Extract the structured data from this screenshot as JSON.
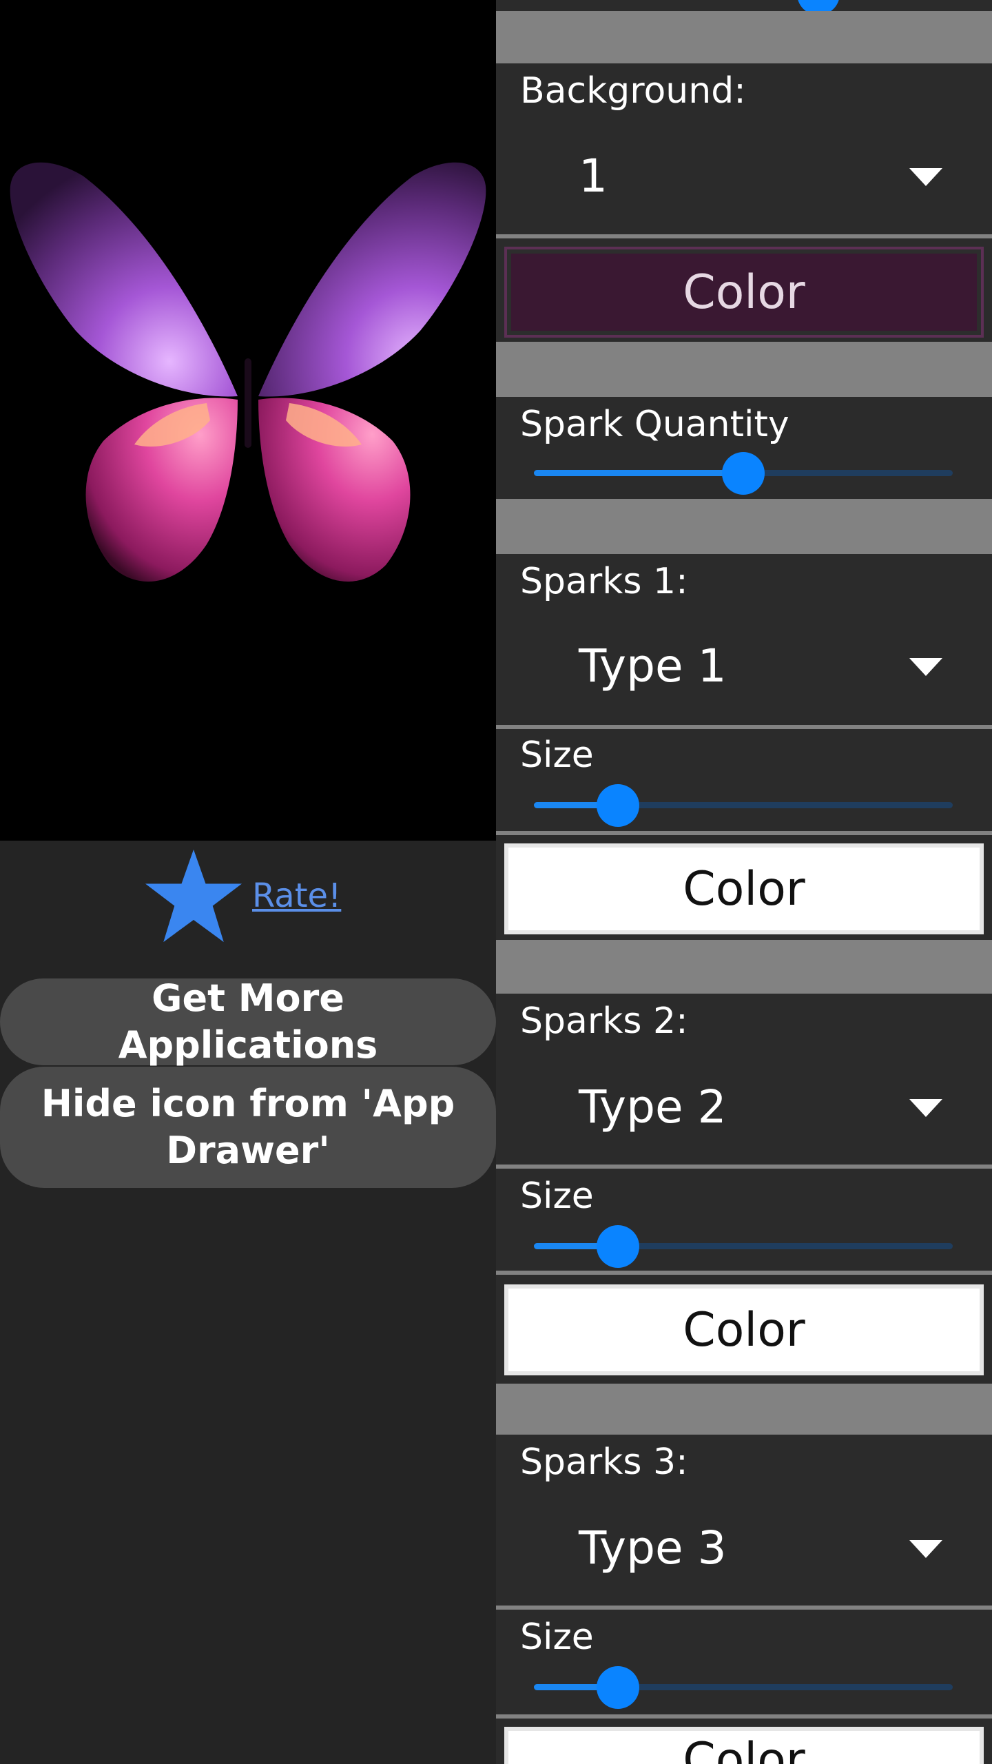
{
  "left": {
    "rate_label": "Rate!",
    "buttons": {
      "more_apps": "Get More Applications",
      "hide_icon": "Hide icon from 'App Drawer'"
    }
  },
  "settings": {
    "background": {
      "label": "Background:",
      "value": "1",
      "color_label": "Color"
    },
    "spark_quantity": {
      "label": "Spark Quantity",
      "level": 0.5
    },
    "sparks": [
      {
        "label": "Sparks 1:",
        "type": "Type 1",
        "size_label": "Size",
        "size_level": 0.2,
        "color_label": "Color"
      },
      {
        "label": "Sparks 2:",
        "type": "Type 2",
        "size_label": "Size",
        "size_level": 0.2,
        "color_label": "Color"
      },
      {
        "label": "Sparks 3:",
        "type": "Type 3",
        "size_label": "Size",
        "size_level": 0.2,
        "color_label": "Color"
      }
    ]
  },
  "colors": {
    "accent": "#0a84ff",
    "link": "#5b8fe8",
    "background_color_swatch": "#3a1832",
    "wing_upper": "#8a3fb0",
    "wing_lower": "#d0409a"
  },
  "icons": [
    "star-icon",
    "dropdown-caret-icon",
    "butterfly-wallpaper-preview"
  ]
}
